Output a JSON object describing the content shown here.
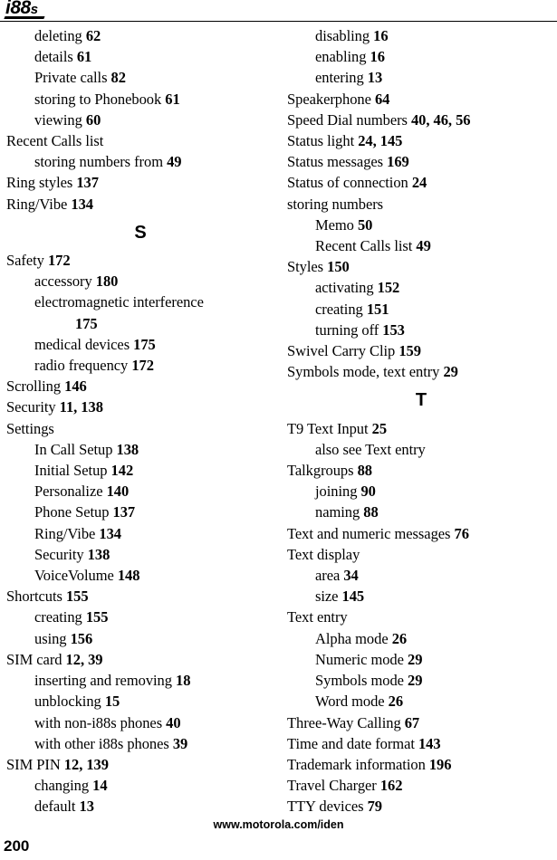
{
  "header": {
    "logo_main": "i88",
    "logo_suffix": "s"
  },
  "footer": {
    "url": "www.motorola.com/iden",
    "page_number": "200"
  },
  "columns": {
    "left": [
      {
        "kind": "entry",
        "level": 1,
        "text": "deleting",
        "pages": "62"
      },
      {
        "kind": "entry",
        "level": 1,
        "text": "details",
        "pages": "61"
      },
      {
        "kind": "entry",
        "level": 1,
        "text": "Private calls",
        "pages": "82"
      },
      {
        "kind": "entry",
        "level": 1,
        "text": "storing to Phonebook",
        "pages": "61"
      },
      {
        "kind": "entry",
        "level": 1,
        "text": "viewing",
        "pages": "60"
      },
      {
        "kind": "entry",
        "level": 0,
        "text": "Recent Calls list",
        "pages": ""
      },
      {
        "kind": "entry",
        "level": 1,
        "text": "storing numbers from",
        "pages": "49"
      },
      {
        "kind": "entry",
        "level": 0,
        "text": "Ring styles",
        "pages": "137"
      },
      {
        "kind": "entry",
        "level": 0,
        "text": "Ring/Vibe",
        "pages": "134"
      },
      {
        "kind": "letter",
        "text": "S"
      },
      {
        "kind": "entry",
        "level": 0,
        "text": "Safety",
        "pages": "172"
      },
      {
        "kind": "entry",
        "level": 1,
        "text": "accessory",
        "pages": "180"
      },
      {
        "kind": "entry",
        "level": 1,
        "text": "electromagnetic interference",
        "pages": ""
      },
      {
        "kind": "entry",
        "level": 2,
        "text": "",
        "pages": "175"
      },
      {
        "kind": "entry",
        "level": 1,
        "text": "medical devices",
        "pages": "175"
      },
      {
        "kind": "entry",
        "level": 1,
        "text": "radio frequency",
        "pages": "172"
      },
      {
        "kind": "entry",
        "level": 0,
        "text": "Scrolling",
        "pages": "146"
      },
      {
        "kind": "entry",
        "level": 0,
        "text": "Security",
        "pages": "11, 138"
      },
      {
        "kind": "entry",
        "level": 0,
        "text": "Settings",
        "pages": ""
      },
      {
        "kind": "entry",
        "level": 1,
        "text": "In Call Setup",
        "pages": "138"
      },
      {
        "kind": "entry",
        "level": 1,
        "text": "Initial Setup",
        "pages": "142"
      },
      {
        "kind": "entry",
        "level": 1,
        "text": "Personalize",
        "pages": "140"
      },
      {
        "kind": "entry",
        "level": 1,
        "text": "Phone Setup",
        "pages": "137"
      },
      {
        "kind": "entry",
        "level": 1,
        "text": "Ring/Vibe",
        "pages": "134"
      },
      {
        "kind": "entry",
        "level": 1,
        "text": "Security",
        "pages": "138"
      },
      {
        "kind": "entry",
        "level": 1,
        "text": "VoiceVolume",
        "pages": "148"
      },
      {
        "kind": "entry",
        "level": 0,
        "text": "Shortcuts",
        "pages": "155"
      },
      {
        "kind": "entry",
        "level": 1,
        "text": "creating",
        "pages": "155"
      },
      {
        "kind": "entry",
        "level": 1,
        "text": "using",
        "pages": "156"
      },
      {
        "kind": "entry",
        "level": 0,
        "text": "SIM card",
        "pages": "12, 39"
      },
      {
        "kind": "entry",
        "level": 1,
        "text": "inserting and removing",
        "pages": "18"
      },
      {
        "kind": "entry",
        "level": 1,
        "text": "unblocking",
        "pages": "15"
      },
      {
        "kind": "entry",
        "level": 1,
        "text": "with non-i88s phones",
        "pages": "40"
      },
      {
        "kind": "entry",
        "level": 1,
        "text": "with other i88s phones",
        "pages": "39"
      },
      {
        "kind": "entry",
        "level": 0,
        "text": "SIM PIN",
        "pages": "12, 139"
      },
      {
        "kind": "entry",
        "level": 1,
        "text": "changing",
        "pages": "14"
      },
      {
        "kind": "entry",
        "level": 1,
        "text": "default",
        "pages": "13"
      }
    ],
    "right": [
      {
        "kind": "entry",
        "level": 1,
        "text": "disabling",
        "pages": "16"
      },
      {
        "kind": "entry",
        "level": 1,
        "text": "enabling",
        "pages": "16"
      },
      {
        "kind": "entry",
        "level": 1,
        "text": "entering",
        "pages": "13"
      },
      {
        "kind": "entry",
        "level": 0,
        "text": "Speakerphone",
        "pages": "64"
      },
      {
        "kind": "entry",
        "level": 0,
        "text": "Speed Dial numbers",
        "pages": "40, 46, 56"
      },
      {
        "kind": "entry",
        "level": 0,
        "text": "Status light",
        "pages": "24, 145"
      },
      {
        "kind": "entry",
        "level": 0,
        "text": "Status messages",
        "pages": "169"
      },
      {
        "kind": "entry",
        "level": 0,
        "text": "Status of connection",
        "pages": "24"
      },
      {
        "kind": "entry",
        "level": 0,
        "text": "storing numbers",
        "pages": ""
      },
      {
        "kind": "entry",
        "level": 1,
        "text": "Memo",
        "pages": "50"
      },
      {
        "kind": "entry",
        "level": 1,
        "text": "Recent Calls list",
        "pages": "49"
      },
      {
        "kind": "entry",
        "level": 0,
        "text": "Styles",
        "pages": "150"
      },
      {
        "kind": "entry",
        "level": 1,
        "text": "activating",
        "pages": "152"
      },
      {
        "kind": "entry",
        "level": 1,
        "text": "creating",
        "pages": "151"
      },
      {
        "kind": "entry",
        "level": 1,
        "text": "turning off",
        "pages": "153"
      },
      {
        "kind": "entry",
        "level": 0,
        "text": "Swivel Carry Clip",
        "pages": "159"
      },
      {
        "kind": "entry",
        "level": 0,
        "text": "Symbols mode, text entry",
        "pages": "29"
      },
      {
        "kind": "letter",
        "text": "T"
      },
      {
        "kind": "entry",
        "level": 0,
        "text": "T9 Text Input",
        "pages": "25"
      },
      {
        "kind": "entry",
        "level": 1,
        "text": "also see Text entry",
        "pages": ""
      },
      {
        "kind": "entry",
        "level": 0,
        "text": "Talkgroups",
        "pages": "88"
      },
      {
        "kind": "entry",
        "level": 1,
        "text": "joining",
        "pages": "90"
      },
      {
        "kind": "entry",
        "level": 1,
        "text": "naming",
        "pages": "88"
      },
      {
        "kind": "entry",
        "level": 0,
        "text": "Text and numeric messages",
        "pages": "76"
      },
      {
        "kind": "entry",
        "level": 0,
        "text": "Text display",
        "pages": ""
      },
      {
        "kind": "entry",
        "level": 1,
        "text": "area",
        "pages": "34"
      },
      {
        "kind": "entry",
        "level": 1,
        "text": "size",
        "pages": "145"
      },
      {
        "kind": "entry",
        "level": 0,
        "text": "Text entry",
        "pages": ""
      },
      {
        "kind": "entry",
        "level": 1,
        "text": "Alpha mode",
        "pages": "26"
      },
      {
        "kind": "entry",
        "level": 1,
        "text": "Numeric mode",
        "pages": "29"
      },
      {
        "kind": "entry",
        "level": 1,
        "text": "Symbols mode",
        "pages": "29"
      },
      {
        "kind": "entry",
        "level": 1,
        "text": "Word mode",
        "pages": "26"
      },
      {
        "kind": "entry",
        "level": 0,
        "text": "Three-Way Calling",
        "pages": "67"
      },
      {
        "kind": "entry",
        "level": 0,
        "text": "Time and date format",
        "pages": "143"
      },
      {
        "kind": "entry",
        "level": 0,
        "text": "Trademark information",
        "pages": "196"
      },
      {
        "kind": "entry",
        "level": 0,
        "text": "Travel Charger",
        "pages": "162"
      },
      {
        "kind": "entry",
        "level": 0,
        "text": "TTY devices",
        "pages": "79"
      }
    ]
  }
}
